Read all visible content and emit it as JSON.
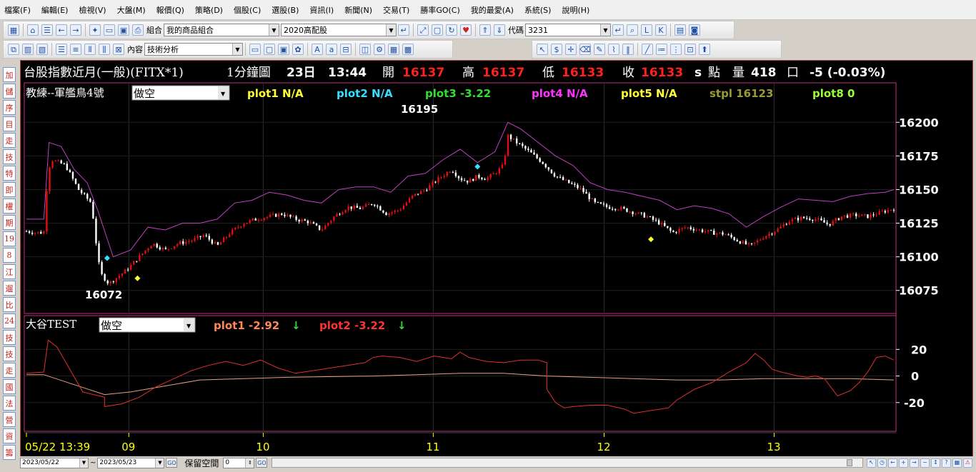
{
  "menu": [
    "檔案(F)",
    "編輯(E)",
    "檢視(V)",
    "大盤(M)",
    "報價(Q)",
    "策略(D)",
    "個股(C)",
    "選股(B)",
    "資訊(I)",
    "新聞(N)",
    "交易(T)",
    "勝率GO(C)",
    "我的最愛(A)",
    "系統(S)",
    "說明(H)"
  ],
  "toolbar1": {
    "group_label": "組合",
    "group_value": "我的商品組合",
    "portfolio_value": "2020高配股",
    "code_label": "代碼",
    "code_value": "3231"
  },
  "toolbar2": {
    "content_label": "內容",
    "content_value": "技術分析"
  },
  "sidebar": [
    "加",
    "儲",
    "序",
    "目",
    "走",
    "技",
    "特",
    "即",
    "權",
    "期",
    "19",
    "8",
    "江",
    "遛",
    "比",
    "24",
    "技",
    "技",
    "走",
    "國",
    "法",
    "營",
    "資",
    "籌"
  ],
  "quote": {
    "symbol": "台股指數近月(一般)(FITX*1)",
    "period": "1分鐘圖",
    "day": "23日",
    "time": "13:44",
    "open_label": "開",
    "open": "16137",
    "high_label": "高",
    "high": "16137",
    "low_label": "低",
    "low": "16133",
    "close_label": "收",
    "close": "16133",
    "close_suffix": "s",
    "unit_label": "點",
    "volume_label": "量",
    "volume": "418",
    "volume_unit": "口",
    "change": "-5 (-0.03%)"
  },
  "main_panel": {
    "strategy_name": "教練--軍艦鳥4號",
    "mode_value": "做空",
    "indicators": [
      {
        "label": "plot1 N/A",
        "color": "#ffff33"
      },
      {
        "label": "plot2 N/A",
        "color": "#33e0ff"
      },
      {
        "label": "plot3 -3.22",
        "color": "#33dd33"
      },
      {
        "label": "plot4 N/A",
        "color": "#ff33ff"
      },
      {
        "label": "plot5 N/A",
        "color": "#ffff33"
      },
      {
        "label": "stpl 16123",
        "color": "#9a9a33"
      },
      {
        "label": "plot8 0",
        "color": "#99ff33"
      }
    ],
    "high_annotation": "16195",
    "low_annotation": "16072"
  },
  "sub_panel": {
    "name": "大谷TEST",
    "mode_value": "做空",
    "indicators": [
      {
        "label": "plot1 -2.92",
        "color": "#ff8855",
        "arrow": "↓"
      },
      {
        "label": "plot2 -3.22",
        "color": "#ff3333",
        "arrow": "↓"
      }
    ]
  },
  "bottom": {
    "start_date": "2023/05/22",
    "tilde": "~",
    "end_date": "2023/05/23",
    "go1": "GO",
    "keep_label": "保留空間",
    "keep_value": "0",
    "go2": "GO"
  },
  "colors": {
    "up": "#e01010",
    "down": "#ffffff",
    "band": "#c040c0",
    "sub_line1": "#e03030",
    "sub_line2": "#e8a080",
    "axis_text": "#ffffff",
    "time_text": "#ffff00",
    "frame": "#c03080"
  },
  "chart_data": {
    "type": "candlestick",
    "x_labels": [
      "05/22 13:39",
      "09",
      "10",
      "11",
      "12",
      "13"
    ],
    "main": {
      "y_ticks": [
        16200,
        16175,
        16150,
        16125,
        16100,
        16075
      ],
      "ylim": [
        16060,
        16215
      ],
      "close_path": [
        [
          0,
          16119
        ],
        [
          0.01,
          16118
        ],
        [
          0.02,
          16118
        ],
        [
          0.025,
          16165
        ],
        [
          0.03,
          16172
        ],
        [
          0.045,
          16168
        ],
        [
          0.06,
          16150
        ],
        [
          0.075,
          16140
        ],
        [
          0.08,
          16112
        ],
        [
          0.085,
          16088
        ],
        [
          0.095,
          16080
        ],
        [
          0.105,
          16085
        ],
        [
          0.115,
          16090
        ],
        [
          0.13,
          16100
        ],
        [
          0.145,
          16110
        ],
        [
          0.16,
          16105
        ],
        [
          0.175,
          16110
        ],
        [
          0.19,
          16112
        ],
        [
          0.205,
          16116
        ],
        [
          0.22,
          16108
        ],
        [
          0.235,
          16118
        ],
        [
          0.25,
          16125
        ],
        [
          0.265,
          16128
        ],
        [
          0.28,
          16130
        ],
        [
          0.295,
          16132
        ],
        [
          0.31,
          16128
        ],
        [
          0.325,
          16126
        ],
        [
          0.34,
          16120
        ],
        [
          0.355,
          16130
        ],
        [
          0.37,
          16137
        ],
        [
          0.385,
          16136
        ],
        [
          0.4,
          16140
        ],
        [
          0.415,
          16132
        ],
        [
          0.43,
          16135
        ],
        [
          0.445,
          16145
        ],
        [
          0.46,
          16150
        ],
        [
          0.475,
          16158
        ],
        [
          0.49,
          16165
        ],
        [
          0.5,
          16158
        ],
        [
          0.51,
          16156
        ],
        [
          0.52,
          16160
        ],
        [
          0.53,
          16158
        ],
        [
          0.54,
          16162
        ],
        [
          0.55,
          16168
        ],
        [
          0.555,
          16190
        ],
        [
          0.565,
          16185
        ],
        [
          0.58,
          16178
        ],
        [
          0.595,
          16170
        ],
        [
          0.61,
          16160
        ],
        [
          0.625,
          16155
        ],
        [
          0.64,
          16150
        ],
        [
          0.655,
          16140
        ],
        [
          0.67,
          16137
        ],
        [
          0.685,
          16136
        ],
        [
          0.7,
          16133
        ],
        [
          0.715,
          16130
        ],
        [
          0.73,
          16125
        ],
        [
          0.745,
          16118
        ],
        [
          0.76,
          16122
        ],
        [
          0.775,
          16120
        ],
        [
          0.79,
          16118
        ],
        [
          0.805,
          16117
        ],
        [
          0.82,
          16112
        ],
        [
          0.835,
          16108
        ],
        [
          0.85,
          16115
        ],
        [
          0.865,
          16120
        ],
        [
          0.88,
          16127
        ],
        [
          0.895,
          16129
        ],
        [
          0.91,
          16128
        ],
        [
          0.925,
          16124
        ],
        [
          0.94,
          16130
        ],
        [
          0.955,
          16131
        ],
        [
          0.97,
          16130
        ],
        [
          0.985,
          16133
        ],
        [
          1.0,
          16136
        ]
      ],
      "band_path": [
        [
          0,
          16128
        ],
        [
          0.02,
          16128
        ],
        [
          0.026,
          16185
        ],
        [
          0.04,
          16182
        ],
        [
          0.055,
          16165
        ],
        [
          0.07,
          16155
        ],
        [
          0.082,
          16135
        ],
        [
          0.1,
          16100
        ],
        [
          0.12,
          16105
        ],
        [
          0.14,
          16122
        ],
        [
          0.16,
          16120
        ],
        [
          0.18,
          16125
        ],
        [
          0.2,
          16125
        ],
        [
          0.22,
          16128
        ],
        [
          0.24,
          16140
        ],
        [
          0.26,
          16142
        ],
        [
          0.28,
          16148
        ],
        [
          0.3,
          16146
        ],
        [
          0.32,
          16142
        ],
        [
          0.34,
          16140
        ],
        [
          0.36,
          16150
        ],
        [
          0.38,
          16152
        ],
        [
          0.4,
          16152
        ],
        [
          0.42,
          16148
        ],
        [
          0.44,
          16160
        ],
        [
          0.46,
          16162
        ],
        [
          0.48,
          16172
        ],
        [
          0.5,
          16180
        ],
        [
          0.52,
          16170
        ],
        [
          0.54,
          16178
        ],
        [
          0.555,
          16200
        ],
        [
          0.57,
          16195
        ],
        [
          0.59,
          16185
        ],
        [
          0.61,
          16175
        ],
        [
          0.63,
          16168
        ],
        [
          0.65,
          16155
        ],
        [
          0.67,
          16150
        ],
        [
          0.69,
          16148
        ],
        [
          0.71,
          16145
        ],
        [
          0.73,
          16142
        ],
        [
          0.75,
          16135
        ],
        [
          0.77,
          16138
        ],
        [
          0.79,
          16136
        ],
        [
          0.81,
          16132
        ],
        [
          0.83,
          16122
        ],
        [
          0.85,
          16130
        ],
        [
          0.87,
          16137
        ],
        [
          0.89,
          16143
        ],
        [
          0.91,
          16142
        ],
        [
          0.93,
          16141
        ],
        [
          0.95,
          16145
        ],
        [
          0.97,
          16147
        ],
        [
          0.99,
          16148
        ],
        [
          1.0,
          16150
        ]
      ]
    },
    "sub": {
      "y_ticks": [
        20,
        0,
        -20
      ],
      "ylim": [
        -40,
        32
      ],
      "line1_path": [
        [
          0,
          2
        ],
        [
          0.02,
          3
        ],
        [
          0.025,
          27
        ],
        [
          0.035,
          22
        ],
        [
          0.05,
          5
        ],
        [
          0.065,
          -12
        ],
        [
          0.09,
          -16
        ],
        [
          0.09,
          -23
        ],
        [
          0.11,
          -21
        ],
        [
          0.13,
          -16
        ],
        [
          0.15,
          -8
        ],
        [
          0.17,
          -2
        ],
        [
          0.19,
          4
        ],
        [
          0.21,
          8
        ],
        [
          0.23,
          11
        ],
        [
          0.25,
          8
        ],
        [
          0.27,
          12
        ],
        [
          0.29,
          6
        ],
        [
          0.31,
          2
        ],
        [
          0.33,
          4
        ],
        [
          0.35,
          6
        ],
        [
          0.37,
          8
        ],
        [
          0.39,
          10
        ],
        [
          0.4,
          14
        ],
        [
          0.41,
          15
        ],
        [
          0.43,
          14
        ],
        [
          0.45,
          11
        ],
        [
          0.47,
          15
        ],
        [
          0.49,
          13
        ],
        [
          0.5,
          18
        ],
        [
          0.51,
          14
        ],
        [
          0.53,
          11
        ],
        [
          0.55,
          10
        ],
        [
          0.57,
          12
        ],
        [
          0.59,
          12
        ],
        [
          0.6,
          10
        ],
        [
          0.6,
          -10
        ],
        [
          0.61,
          -20
        ],
        [
          0.62,
          -24
        ],
        [
          0.63,
          -23
        ],
        [
          0.65,
          -22
        ],
        [
          0.67,
          -22
        ],
        [
          0.69,
          -25
        ],
        [
          0.7,
          -28
        ],
        [
          0.72,
          -26
        ],
        [
          0.74,
          -24
        ],
        [
          0.75,
          -18
        ],
        [
          0.77,
          -10
        ],
        [
          0.79,
          -5
        ],
        [
          0.81,
          3
        ],
        [
          0.83,
          10
        ],
        [
          0.84,
          17
        ],
        [
          0.85,
          12
        ],
        [
          0.86,
          5
        ],
        [
          0.87,
          3
        ],
        [
          0.89,
          0
        ],
        [
          0.9,
          -1
        ],
        [
          0.91,
          0
        ],
        [
          0.92,
          -2
        ],
        [
          0.935,
          -15
        ],
        [
          0.95,
          -11
        ],
        [
          0.96,
          -5
        ],
        [
          0.97,
          3
        ],
        [
          0.98,
          14
        ],
        [
          0.99,
          15
        ],
        [
          1.0,
          12
        ]
      ],
      "line2_path": [
        [
          0,
          1
        ],
        [
          0.02,
          1
        ],
        [
          0.09,
          -14
        ],
        [
          0.12,
          -12
        ],
        [
          0.2,
          -3
        ],
        [
          0.3,
          -1
        ],
        [
          0.4,
          0
        ],
        [
          0.45,
          1
        ],
        [
          0.5,
          2
        ],
        [
          0.55,
          2
        ],
        [
          0.6,
          0
        ],
        [
          0.65,
          -1
        ],
        [
          0.7,
          -2
        ],
        [
          0.75,
          -3
        ],
        [
          0.8,
          -3
        ],
        [
          0.85,
          -2
        ],
        [
          0.9,
          -2
        ],
        [
          0.95,
          -2
        ],
        [
          1.0,
          -3
        ]
      ]
    }
  }
}
